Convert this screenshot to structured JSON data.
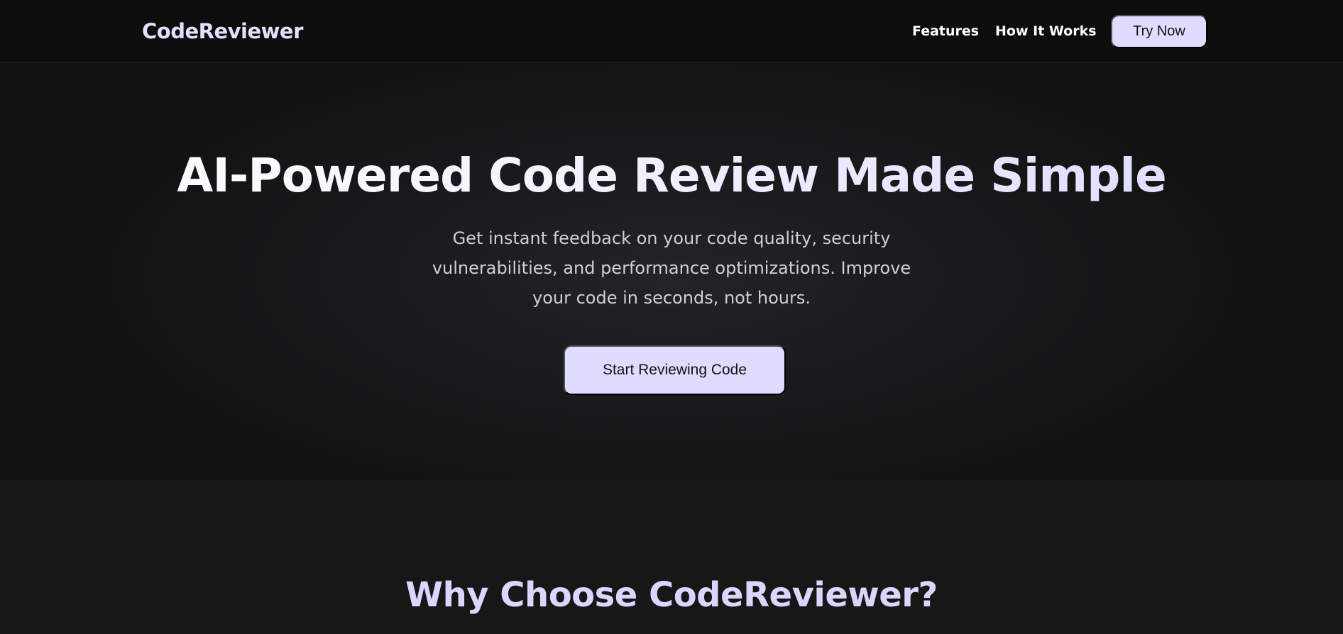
{
  "nav": {
    "brand": "CodeReviewer",
    "links": [
      "Features",
      "How It Works"
    ],
    "cta": "Try Now"
  },
  "hero": {
    "title": "AI-Powered Code Review Made Simple",
    "subtitle": "Get instant feedback on your code quality, security vulnerabilities, and performance optimizations. Improve your code in seconds, not hours.",
    "cta": "Start Reviewing Code"
  },
  "features": {
    "title": "Why Choose CodeReviewer?"
  },
  "colors": {
    "accent": "#dedcff",
    "heading_accent": "#d9d6ff",
    "background": "#161616",
    "navbar": "#0d0d0d"
  }
}
